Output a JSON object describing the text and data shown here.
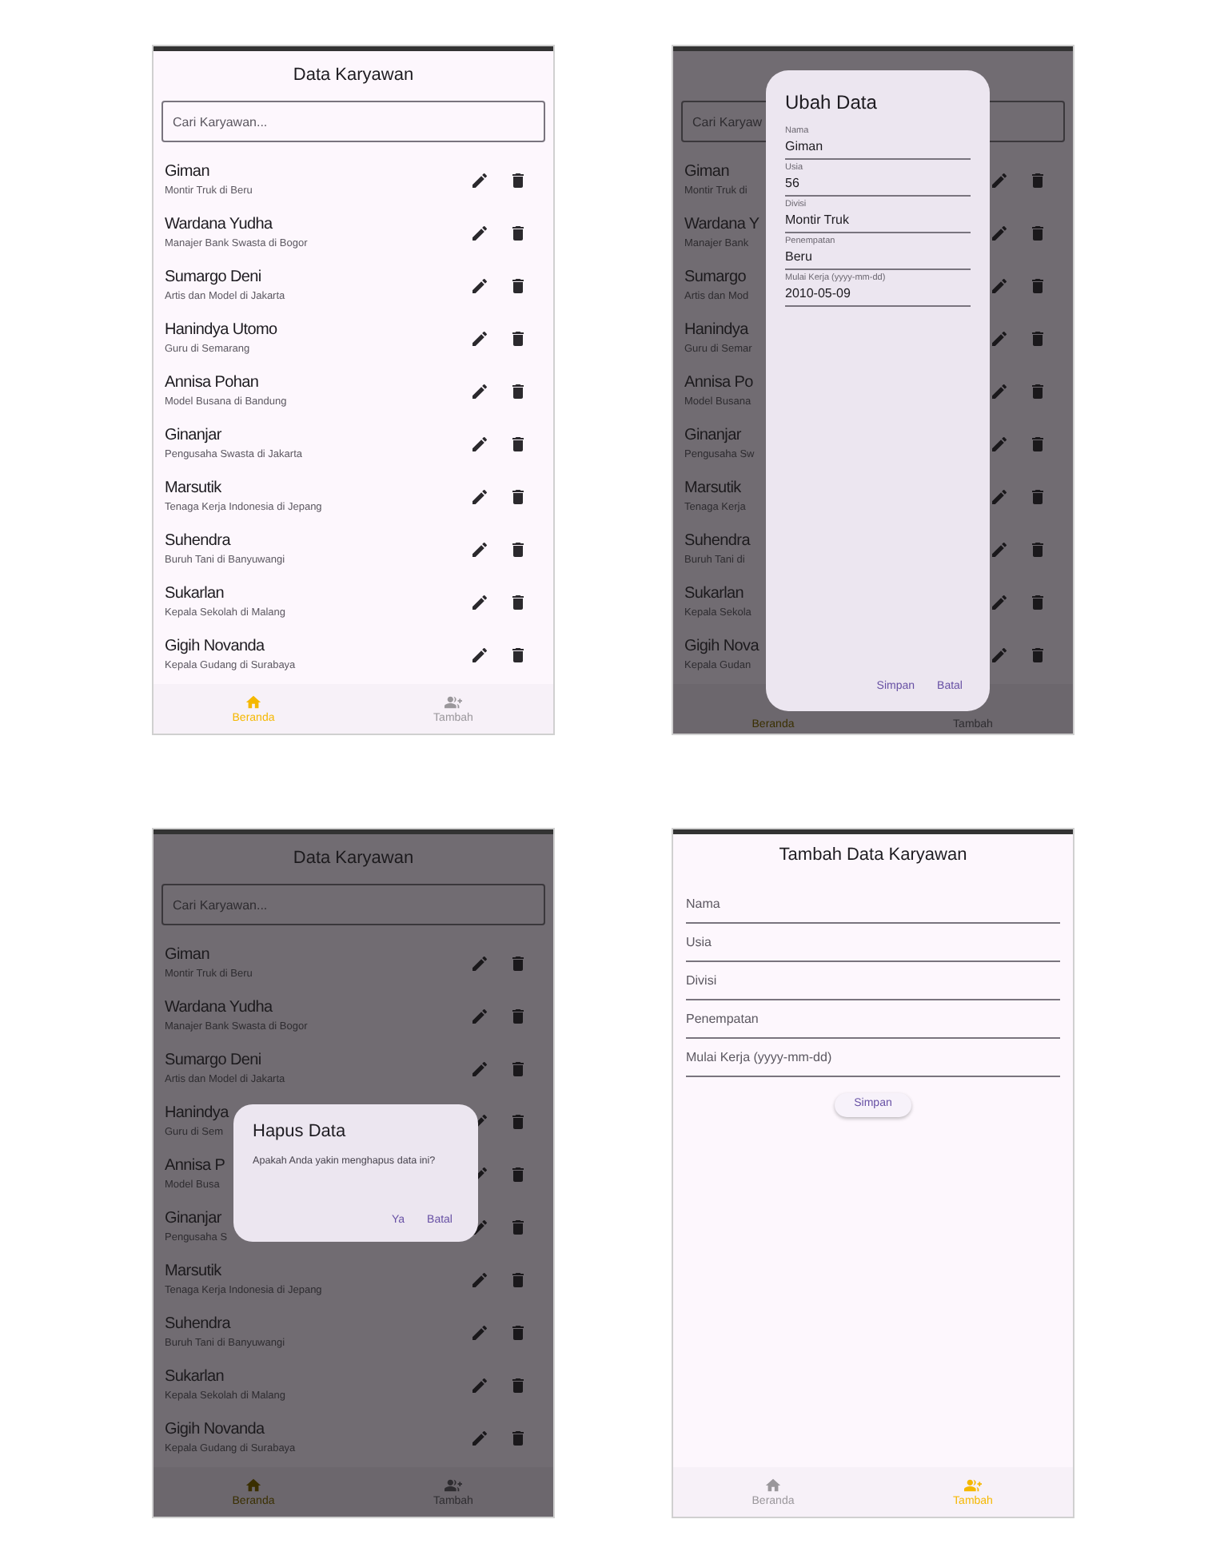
{
  "screens": [
    {
      "kind": "list",
      "dimmed": false,
      "title": "Data Karyawan",
      "search": {
        "placeholder": "Cari Karyawan..."
      },
      "employees": [
        {
          "name": "Giman",
          "detail": "Montir Truk di Beru"
        },
        {
          "name": "Wardana Yudha",
          "detail": "Manajer Bank Swasta di Bogor"
        },
        {
          "name": "Sumargo Deni",
          "detail": "Artis dan Model di Jakarta"
        },
        {
          "name": "Hanindya Utomo",
          "detail": "Guru di Semarang"
        },
        {
          "name": "Annisa Pohan",
          "detail": "Model Busana di Bandung"
        },
        {
          "name": "Ginanjar",
          "detail": "Pengusaha Swasta di Jakarta"
        },
        {
          "name": "Marsutik",
          "detail": "Tenaga Kerja Indonesia di Jepang"
        },
        {
          "name": "Suhendra",
          "detail": "Buruh Tani di Banyuwangi"
        },
        {
          "name": "Sukarlan",
          "detail": "Kepala Sekolah di Malang"
        },
        {
          "name": "Gigih Novanda",
          "detail": "Kepala Gudang di Surabaya"
        }
      ],
      "nav": [
        {
          "label": "Beranda",
          "selected": true
        },
        {
          "label": "Tambah",
          "selected": false
        }
      ]
    },
    {
      "kind": "list",
      "dimmed": true,
      "search": {
        "placeholder": "Cari Karyaw"
      },
      "employees": [
        {
          "name": "Giman",
          "detail": "Montir Truk di"
        },
        {
          "name": "Wardana Y",
          "detail": "Manajer Bank"
        },
        {
          "name": "Sumargo",
          "detail": "Artis dan Mod"
        },
        {
          "name": "Hanindya",
          "detail": "Guru di Semar"
        },
        {
          "name": "Annisa Po",
          "detail": "Model Busana"
        },
        {
          "name": "Ginanjar",
          "detail": "Pengusaha Sw"
        },
        {
          "name": "Marsutik",
          "detail": "Tenaga Kerja"
        },
        {
          "name": "Suhendra",
          "detail": "Buruh Tani di"
        },
        {
          "name": "Sukarlan",
          "detail": "Kepala Sekola"
        },
        {
          "name": "Gigih Nova",
          "detail": "Kepala Gudan"
        }
      ],
      "nav": [
        {
          "label": "Beranda",
          "selected": true
        },
        {
          "label": "Tambah",
          "selected": false
        }
      ],
      "dialog": {
        "kind": "edit",
        "title": "Ubah Data",
        "fields": [
          {
            "label": "Nama",
            "value": "Giman"
          },
          {
            "label": "Usia",
            "value": "56"
          },
          {
            "label": "Divisi",
            "value": "Montir Truk"
          },
          {
            "label": "Penempatan",
            "value": "Beru"
          },
          {
            "label": "Mulai Kerja (yyyy-mm-dd)",
            "value": "2010-05-09"
          }
        ],
        "actions": [
          "Simpan",
          "Batal"
        ]
      }
    },
    {
      "kind": "list",
      "dimmed": true,
      "title": "Data Karyawan",
      "search": {
        "placeholder": "Cari Karyawan..."
      },
      "employees": [
        {
          "name": "Giman",
          "detail": "Montir Truk di Beru"
        },
        {
          "name": "Wardana Yudha",
          "detail": "Manajer Bank Swasta di Bogor"
        },
        {
          "name": "Sumargo Deni",
          "detail": "Artis dan Model di Jakarta"
        },
        {
          "name": "Hanindya",
          "detail": "Guru di Sem"
        },
        {
          "name": "Annisa P",
          "detail": "Model Busa"
        },
        {
          "name": "Ginanjar",
          "detail": "Pengusaha S"
        },
        {
          "name": "Marsutik",
          "detail": "Tenaga Kerja Indonesia di Jepang"
        },
        {
          "name": "Suhendra",
          "detail": "Buruh Tani di Banyuwangi"
        },
        {
          "name": "Sukarlan",
          "detail": "Kepala Sekolah di Malang"
        },
        {
          "name": "Gigih Novanda",
          "detail": "Kepala Gudang di Surabaya"
        }
      ],
      "nav": [
        {
          "label": "Beranda",
          "selected": true
        },
        {
          "label": "Tambah",
          "selected": false
        }
      ],
      "dialog": {
        "kind": "confirm",
        "title": "Hapus Data",
        "message": "Apakah Anda yakin menghapus data ini?",
        "actions": [
          "Ya",
          "Batal"
        ]
      }
    },
    {
      "kind": "form",
      "title": "Tambah Data Karyawan",
      "fields": [
        {
          "placeholder": "Nama"
        },
        {
          "placeholder": "Usia"
        },
        {
          "placeholder": "Divisi"
        },
        {
          "placeholder": "Penempatan"
        },
        {
          "placeholder": "Mulai Kerja (yyyy-mm-dd)"
        }
      ],
      "submit": "Simpan",
      "nav": [
        {
          "label": "Beranda",
          "selected": false
        },
        {
          "label": "Tambah",
          "selected": true
        }
      ]
    }
  ]
}
